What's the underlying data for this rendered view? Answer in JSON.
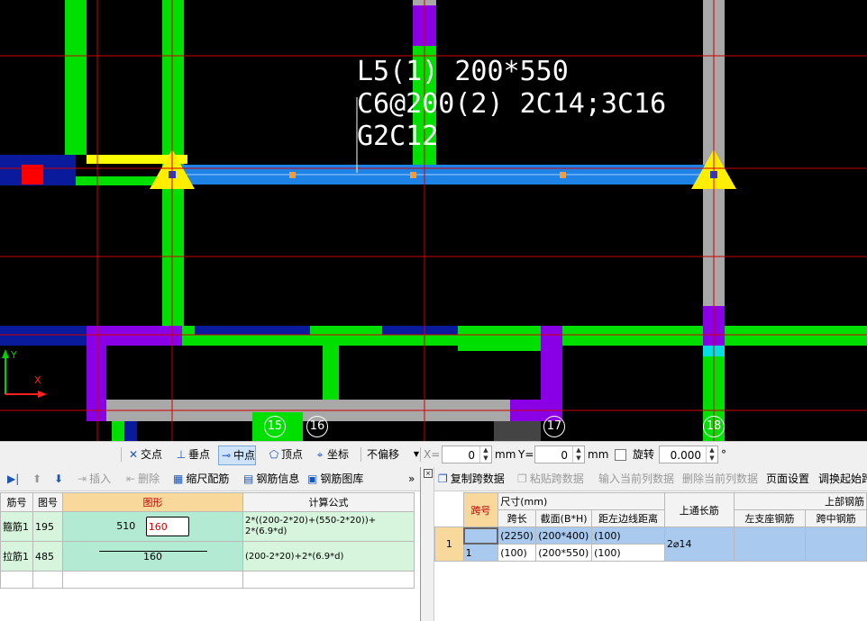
{
  "canvas": {
    "beam_label": {
      "line1": "L5(1) 200*550",
      "line2": "C6@200(2) 2C14;3C16",
      "line3": "G2C12"
    },
    "axis_y_label": "Y",
    "axis_x_label": "X",
    "grid_labels": [
      "15",
      "16",
      "17",
      "18"
    ]
  },
  "snap_toolbar": {
    "intersection": "交点",
    "perpendicular": "垂点",
    "midpoint": "中点",
    "vertex": "顶点",
    "coordinate": "坐标",
    "offset_mode": "不偏移",
    "x_label": "X=",
    "x_value": "0",
    "x_unit": "mm",
    "y_label": "Y=",
    "y_value": "0",
    "y_unit": "mm",
    "rotate_label": "旋转",
    "rotate_value": "0.000",
    "degree": "°"
  },
  "rebar_toolbar": {
    "insert": "插入",
    "delete": "删除",
    "scale": "缩尺配筋",
    "info": "钢筋信息",
    "library": "钢筋图库",
    "more": "»"
  },
  "rebar_table": {
    "headers": [
      "筋号",
      "图号",
      "图形",
      "计算公式"
    ],
    "rows": [
      {
        "name": "箍筋1",
        "fig": "195",
        "shape_a": "510",
        "shape_b": "160",
        "formula_1": "2*((200-2*20)+(550-2*20))+",
        "formula_2": "2*(6.9*d)"
      },
      {
        "name": "拉筋1",
        "fig": "485",
        "shape_a": "160",
        "shape_b": "",
        "formula_1": "(200-2*20)+2*(6.9*d)",
        "formula_2": ""
      }
    ]
  },
  "span_toolbar": {
    "copy": "复制跨数据",
    "paste": "粘贴跨数据",
    "input_col": "输入当前列数据",
    "delete_col": "删除当前列数据",
    "page_setup": "页面设置",
    "adjust_start": "调换起始跨"
  },
  "span_table": {
    "h_span": "跨号",
    "h_size": "尺寸(mm)",
    "h_len": "跨长",
    "h_section": "截面(B*H)",
    "h_edge": "距左边线距离",
    "h_top": "上通长筋",
    "h_upper": "上部钢筋",
    "h_left_seat": "左支座钢筋",
    "h_mid": "跨中钢筋",
    "row_num": "1",
    "cell_span": "1",
    "len_1": "(2250)",
    "section_1": "(200*400)",
    "edge_1": "(100)",
    "len_2": "(100)",
    "section_2": "(200*550)",
    "edge_2": "(100)",
    "top_bar": "2⌀14"
  }
}
